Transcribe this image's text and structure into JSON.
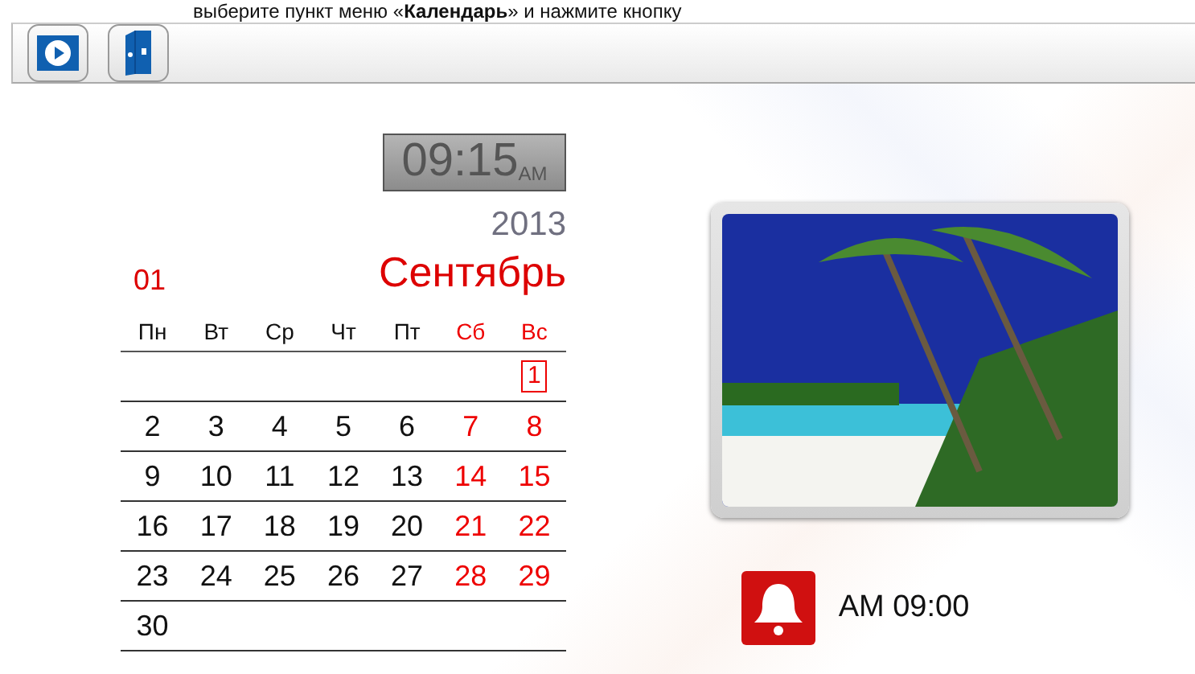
{
  "instruction": "выберите пункт меню «**Календарь**» и нажмите кнопку",
  "toolbar": {
    "buttons": [
      {
        "kind": "play"
      },
      {
        "kind": "binder"
      }
    ]
  },
  "clock": {
    "time": "09:15",
    "period": "AM"
  },
  "calendar": {
    "year": "2013",
    "month_number": "01",
    "month": "Сентябрь",
    "weekdays": [
      {
        "label": "Пн",
        "weekend": false
      },
      {
        "label": "Вт",
        "weekend": false
      },
      {
        "label": "Ср",
        "weekend": false
      },
      {
        "label": "Чт",
        "weekend": false
      },
      {
        "label": "Пт",
        "weekend": false
      },
      {
        "label": "Сб",
        "weekend": true
      },
      {
        "label": "Вс",
        "weekend": true
      }
    ],
    "weeks": [
      [
        {
          "day": "1",
          "weekend": true,
          "selected": true
        }
      ],
      [
        {
          "day": "2",
          "weekend": false,
          "selected": false
        },
        {
          "day": "3",
          "weekend": false,
          "selected": false
        },
        {
          "day": "4",
          "weekend": false,
          "selected": false
        },
        {
          "day": "5",
          "weekend": false,
          "selected": false
        },
        {
          "day": "6",
          "weekend": false,
          "selected": false
        },
        {
          "day": "7",
          "weekend": true,
          "selected": false
        },
        {
          "day": "8",
          "weekend": true,
          "selected": false
        }
      ],
      [
        {
          "day": "9",
          "weekend": false,
          "selected": false
        },
        {
          "day": "10",
          "weekend": false,
          "selected": false
        },
        {
          "day": "11",
          "weekend": false,
          "selected": false
        },
        {
          "day": "12",
          "weekend": false,
          "selected": false
        },
        {
          "day": "13",
          "weekend": false,
          "selected": false
        },
        {
          "day": "14",
          "weekend": true,
          "selected": false
        },
        {
          "day": "15",
          "weekend": true,
          "selected": false
        }
      ],
      [
        {
          "day": "16",
          "weekend": false,
          "selected": false
        },
        {
          "day": "17",
          "weekend": false,
          "selected": false
        },
        {
          "day": "18",
          "weekend": false,
          "selected": false
        },
        {
          "day": "19",
          "weekend": false,
          "selected": false
        },
        {
          "day": "20",
          "weekend": false,
          "selected": false
        },
        {
          "day": "21",
          "weekend": true,
          "selected": false
        },
        {
          "day": "22",
          "weekend": true,
          "selected": false
        }
      ],
      [
        {
          "day": "23",
          "weekend": false,
          "selected": false
        },
        {
          "day": "24",
          "weekend": false,
          "selected": false
        },
        {
          "day": "25",
          "weekend": false,
          "selected": false
        },
        {
          "day": "26",
          "weekend": false,
          "selected": false
        },
        {
          "day": "27",
          "weekend": false,
          "selected": false
        },
        {
          "day": "28",
          "weekend": true,
          "selected": false
        },
        {
          "day": "29",
          "weekend": true,
          "selected": false
        }
      ],
      [
        {
          "day": "30",
          "weekend": false,
          "selected": false
        }
      ]
    ]
  },
  "alarm": {
    "time": "AM 09:00"
  }
}
